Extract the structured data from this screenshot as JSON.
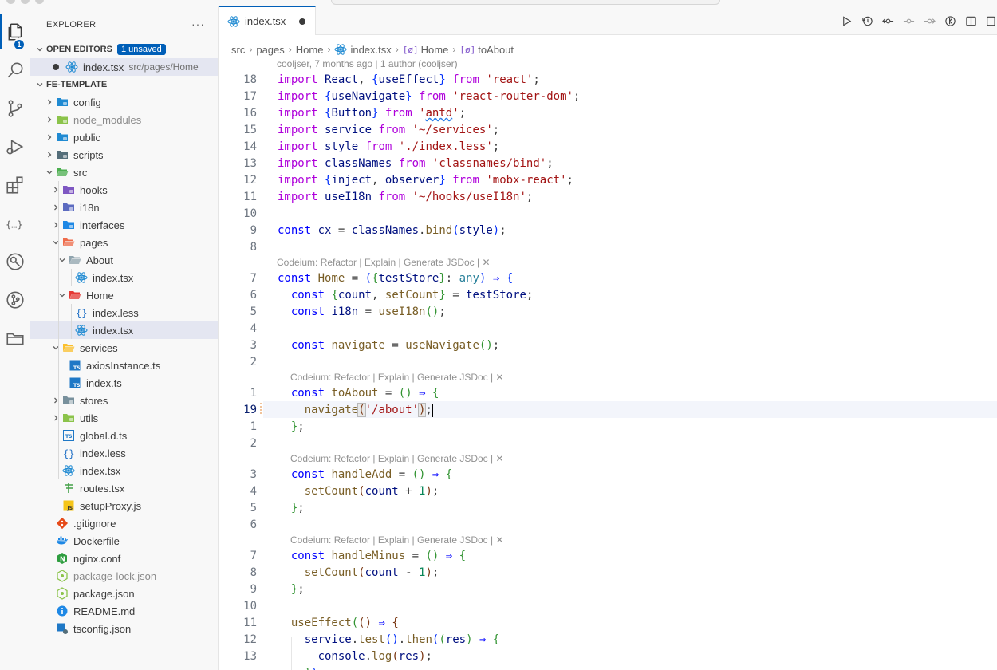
{
  "window": {
    "search_text": "fe-template"
  },
  "activity_bar": {
    "items": [
      {
        "name": "explorer",
        "badge": "1"
      },
      {
        "name": "search"
      },
      {
        "name": "source-control"
      },
      {
        "name": "run-debug"
      },
      {
        "name": "extensions"
      },
      {
        "name": "json-tools"
      },
      {
        "name": "remote-explorer"
      },
      {
        "name": "git-graph"
      },
      {
        "name": "folders"
      }
    ]
  },
  "sidebar": {
    "title": "EXPLORER",
    "more": "···",
    "open_editors": {
      "label": "OPEN EDITORS",
      "badge": "1 unsaved",
      "file": "index.tsx",
      "path": "src/pages/Home"
    },
    "project": "FE-TEMPLATE",
    "tree": [
      {
        "label": "config",
        "kind": "folder",
        "color": "#1f8ad2"
      },
      {
        "label": "node_modules",
        "kind": "folder",
        "color": "#8bc34a",
        "dim": true
      },
      {
        "label": "public",
        "kind": "folder",
        "color": "#1f8ad2"
      },
      {
        "label": "scripts",
        "kind": "folder",
        "color": "#546e7a"
      },
      {
        "label": "src",
        "kind": "folder-open",
        "color": "#4caf50"
      },
      {
        "label": "hooks",
        "kind": "folder",
        "color": "#7e57c2"
      },
      {
        "label": "i18n",
        "kind": "folder",
        "color": "#5c6bc0"
      },
      {
        "label": "interfaces",
        "kind": "folder",
        "color": "#1e88e5"
      },
      {
        "label": "pages",
        "kind": "folder-open",
        "color": "#ef6c4b"
      },
      {
        "label": "About",
        "kind": "folder-open",
        "color": "#90a4ae"
      },
      {
        "label": "index.tsx",
        "kind": "react"
      },
      {
        "label": "Home",
        "kind": "folder-open",
        "color": "#e53935"
      },
      {
        "label": "index.less",
        "kind": "less"
      },
      {
        "label": "index.tsx",
        "kind": "react"
      },
      {
        "label": "services",
        "kind": "folder-open",
        "color": "#fbc02d"
      },
      {
        "label": "axiosInstance.ts",
        "kind": "ts"
      },
      {
        "label": "index.ts",
        "kind": "ts"
      },
      {
        "label": "stores",
        "kind": "folder",
        "color": "#78909c"
      },
      {
        "label": "utils",
        "kind": "folder",
        "color": "#8bc34a"
      },
      {
        "label": "global.d.ts",
        "kind": "dts"
      },
      {
        "label": "index.less",
        "kind": "less"
      },
      {
        "label": "index.tsx",
        "kind": "react"
      },
      {
        "label": "routes.tsx",
        "kind": "routes"
      },
      {
        "label": "setupProxy.js",
        "kind": "js"
      },
      {
        "label": ".gitignore",
        "kind": "git"
      },
      {
        "label": "Dockerfile",
        "kind": "docker"
      },
      {
        "label": "nginx.conf",
        "kind": "nginx"
      },
      {
        "label": "package-lock.json",
        "kind": "node",
        "dim": true
      },
      {
        "label": "package.json",
        "kind": "node"
      },
      {
        "label": "README.md",
        "kind": "info"
      },
      {
        "label": "tsconfig.json",
        "kind": "tsconfig"
      }
    ]
  },
  "editor": {
    "tab": {
      "label": "index.tsx",
      "dirty": true
    },
    "breadcrumb": [
      "src",
      "pages",
      "Home",
      "index.tsx",
      "Home",
      "toAbout"
    ],
    "blame": "cooljser, 7 months ago | 1 author (cooljser)",
    "codelens": "Codeium: Refactor | Explain | Generate JSDoc | ✕",
    "line_numbers": [
      "18",
      "17",
      "16",
      "15",
      "14",
      "13",
      "12",
      "11",
      "10",
      "9",
      "8",
      "7",
      "6",
      "5",
      "4",
      "3",
      "2",
      "1",
      "19",
      "1",
      "2",
      "3",
      "4",
      "5",
      "6",
      "7",
      "8",
      "9",
      "10",
      "11",
      "12",
      "13"
    ],
    "current_line": "19"
  }
}
